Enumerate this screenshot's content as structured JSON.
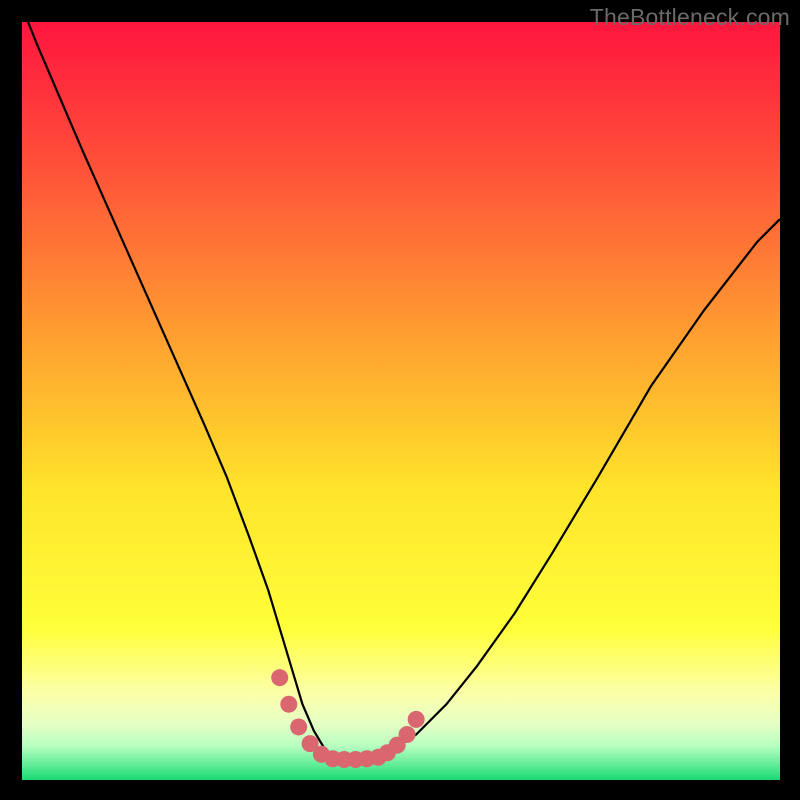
{
  "watermark": "TheBottleneck.com",
  "colors": {
    "frame_bg": "#000000",
    "grad_top": "#ff163e",
    "grad_upper_mid": "#ff8b33",
    "grad_mid": "#ffe829",
    "grad_lower_mid": "#fbff8c",
    "grad_band_pale": "#d9ffb0",
    "grad_bottom": "#20e47a",
    "curve": "#000000",
    "marker_fill": "#da6770",
    "marker_stroke": "#da6770"
  },
  "chart_data": {
    "type": "line",
    "title": "",
    "xlabel": "",
    "ylabel": "",
    "xlim": [
      0,
      100
    ],
    "ylim": [
      0,
      100
    ],
    "series": [
      {
        "name": "bottleneck-curve",
        "x": [
          0,
          2,
          5,
          8,
          12,
          16,
          20,
          24,
          27,
          30,
          32.5,
          34,
          35.5,
          37,
          38.5,
          40,
          41.5,
          43,
          45,
          47,
          49,
          52,
          56,
          60,
          65,
          70,
          76,
          83,
          90,
          97,
          100
        ],
        "y": [
          102,
          97,
          90,
          83,
          74,
          65,
          56,
          47,
          40,
          32,
          25,
          20,
          15,
          10,
          6.5,
          4,
          3,
          3,
          3,
          3.2,
          4,
          6,
          10,
          15,
          22,
          30,
          40,
          52,
          62,
          71,
          74
        ]
      },
      {
        "name": "bottom-markers",
        "x": [
          34.0,
          35.2,
          36.5,
          38.0,
          39.5,
          41.0,
          42.5,
          44.0,
          45.5,
          47.0,
          48.2,
          49.5,
          50.8,
          52.0
        ],
        "y": [
          13.5,
          10.0,
          7.0,
          4.8,
          3.4,
          2.8,
          2.7,
          2.7,
          2.8,
          3.0,
          3.6,
          4.6,
          6.0,
          8.0
        ]
      }
    ]
  }
}
